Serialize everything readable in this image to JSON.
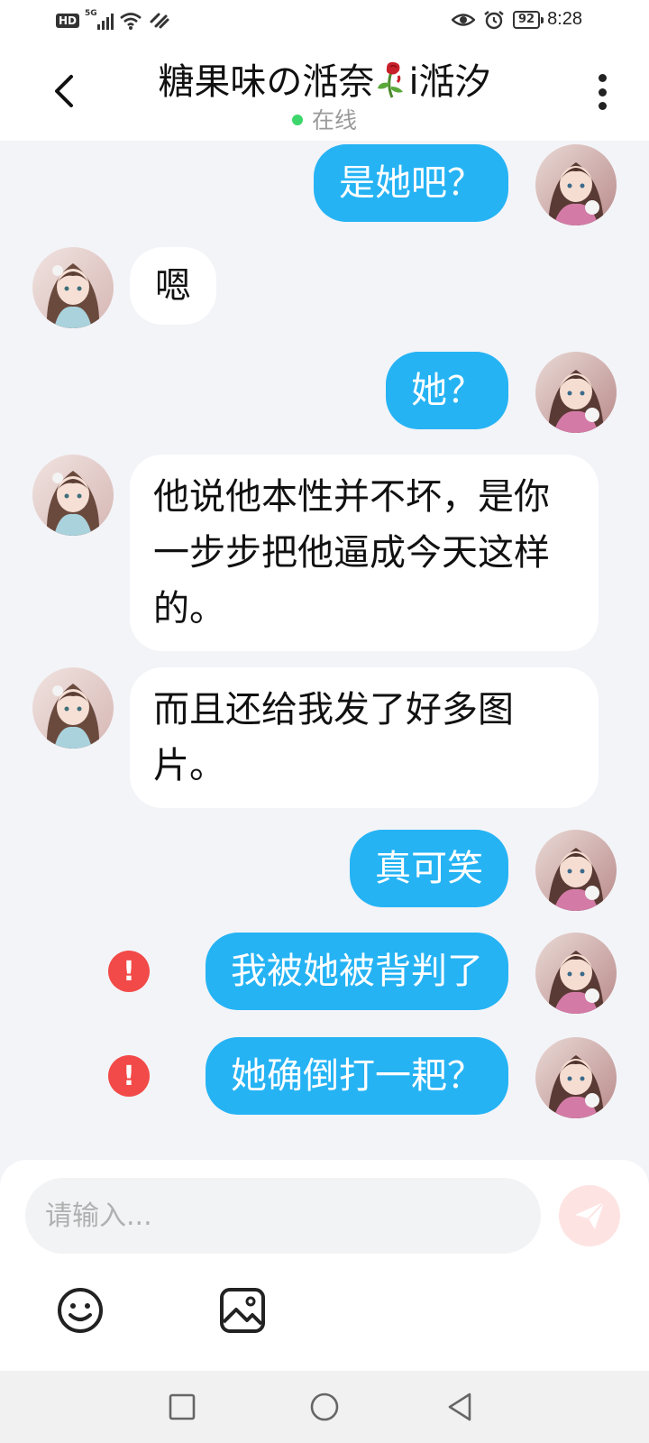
{
  "status_bar": {
    "hd": "HD",
    "network": "5G",
    "battery": "92",
    "time": "8:28"
  },
  "header": {
    "title_part1": "糖果味の湉奈",
    "title_part2": "i湉汐",
    "title_emoji": "rose-wilted-icon",
    "online_label": "在线",
    "online_color": "#3dd66b"
  },
  "messages": [
    {
      "side": "out",
      "text": "是她吧？",
      "failed": false
    },
    {
      "side": "in",
      "text": "嗯",
      "failed": false
    },
    {
      "side": "out",
      "text": "她？",
      "failed": false
    },
    {
      "side": "in",
      "text": "他说他本性并不坏，是你一步步把他逼成今天这样的。",
      "failed": false
    },
    {
      "side": "in",
      "text": "而且还给我发了好多图片。",
      "failed": false
    },
    {
      "side": "out",
      "text": "真可笑",
      "failed": false
    },
    {
      "side": "out",
      "text": "我被她被背判了",
      "failed": true
    },
    {
      "side": "out",
      "text": "她确倒打一耙？",
      "failed": true
    }
  ],
  "error_mark": "!",
  "input": {
    "placeholder": "请输入..."
  },
  "colors": {
    "outgoing_bubble": "#25b3f4",
    "incoming_bubble": "#ffffff",
    "error": "#f24a48",
    "background": "#f3f4f8",
    "send_button": "#fde4e3"
  },
  "icons": {
    "back": "chevron-left-icon",
    "more": "more-vertical-icon",
    "send": "paper-plane-icon",
    "emoji": "smiley-icon",
    "image": "image-icon",
    "nav_recent": "square-icon",
    "nav_home": "circle-icon",
    "nav_back": "triangle-back-icon"
  }
}
